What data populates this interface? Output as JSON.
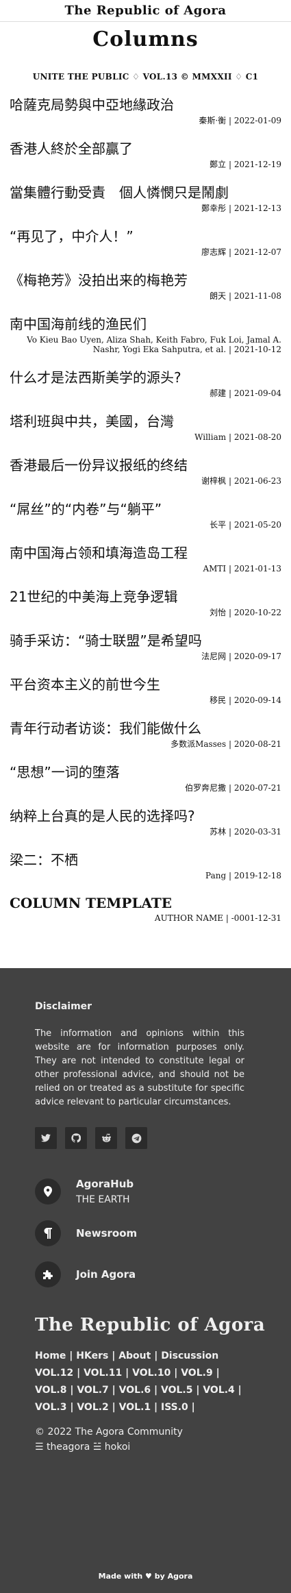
{
  "header": {
    "brand": "The Republic of Agora"
  },
  "page": {
    "heading": "Columns",
    "masthead": "UNITE THE PUBLIC ♢ VOL.13 © MMXXII ♢ C1"
  },
  "articles": [
    {
      "title": "哈薩克局勢與中亞地緣政治",
      "author": "秦斯·衡",
      "date": "2022-01-09"
    },
    {
      "title": "香港人終於全部贏了",
      "author": "鄭立",
      "date": "2021-12-19"
    },
    {
      "title": "當集體行動受責　個人憐憫只是鬧劇",
      "author": "鄭幸彤",
      "date": "2021-12-13"
    },
    {
      "title": "“再见了，中介人！”",
      "author": "廖志辉",
      "date": "2021-12-07"
    },
    {
      "title": "《梅艳芳》没拍出来的梅艳芳",
      "author": "朗天",
      "date": "2021-11-08"
    },
    {
      "title": "南中国海前线的渔民们",
      "author": "Vo Kieu Bao Uyen, Aliza Shah, Keith Fabro, Fuk Loi, Jamal A. Nashr, Yogi Eka Sahputra, et al.",
      "date": "2021-10-12"
    },
    {
      "title": "什么才是法西斯美学的源头?",
      "author": "郝建",
      "date": "2021-09-04"
    },
    {
      "title": "塔利班與中共，美國，台灣",
      "author": "William",
      "date": "2021-08-20"
    },
    {
      "title": "香港最后一份异议报纸的终结",
      "author": "谢梓枫",
      "date": "2021-06-23"
    },
    {
      "title": "“屌丝”的“内卷”与“躺平”",
      "author": "长平",
      "date": "2021-05-20"
    },
    {
      "title": "南中国海占领和填海造岛工程",
      "author": "AMTI",
      "date": "2021-01-13"
    },
    {
      "title": "21世纪的中美海上竞争逻辑",
      "author": "刘怡",
      "date": "2020-10-22"
    },
    {
      "title": "骑手采访：“骑士联盟”是希望吗",
      "author": "法尼网",
      "date": "2020-09-17"
    },
    {
      "title": "平台资本主义的前世今生",
      "author": "移民",
      "date": "2020-09-14"
    },
    {
      "title": "青年行动者访谈：我们能做什么",
      "author": "多数派Masses",
      "date": "2020-08-21"
    },
    {
      "title": "“思想”一词的堕落",
      "author": "伯罗奔尼撒",
      "date": "2020-07-21"
    },
    {
      "title": "纳粹上台真的是人民的选择吗?",
      "author": "苏林",
      "date": "2020-03-31"
    },
    {
      "title": "梁二：不栖",
      "author": "Pang",
      "date": "2019-12-18"
    }
  ],
  "template": {
    "title": "COLUMN TEMPLATE",
    "author": "AUTHOR NAME",
    "date": "-0001-12-31"
  },
  "footer": {
    "disclaimer_title": "Disclaimer",
    "disclaimer_text": "The information and opinions within this website are for information purposes only. They are not intended to constitute legal or other professional advice, and should not be relied on or treated as a substitute for specific advice relevant to particular circumstances.",
    "social": [
      "twitter-icon",
      "github-icon",
      "reddit-icon",
      "telegram-icon"
    ],
    "links": [
      {
        "title": "AgoraHub",
        "subtitle": "THE EARTH",
        "icon": "location-pin-icon"
      },
      {
        "title": "Newsroom",
        "subtitle": "",
        "icon": "paragraph-icon"
      },
      {
        "title": "Join Agora",
        "subtitle": "",
        "icon": "puzzle-icon"
      }
    ],
    "brand": "The Republic of Agora",
    "nav_lines": [
      "Home | HKers | About | Discussion",
      "VOL.12  |  VOL.11  |  VOL.10  |  VOL.9  |",
      "VOL.8 | VOL.7 | VOL.6 | VOL.5 | VOL.4 |",
      "VOL.3 | VOL.2 | VOL.1 | ISS.0 |"
    ],
    "copyright": "© 2022 The Agora Community",
    "handles": "☰ theagora ☱ hokoi",
    "made_with": "Made with ♥ by Agora"
  },
  "colors": {
    "footer_bg": "#424242",
    "icon_bg": "#2b2b2b"
  }
}
